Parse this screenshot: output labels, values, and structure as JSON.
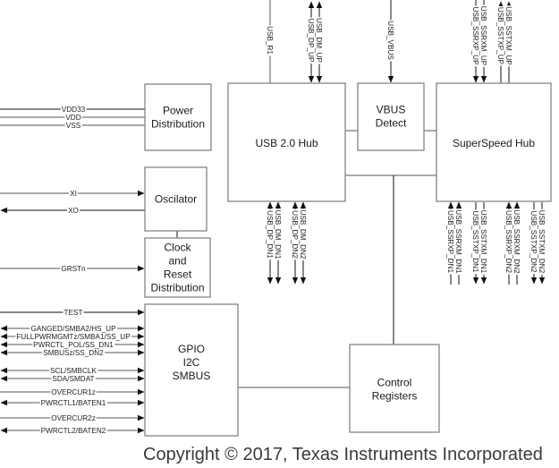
{
  "blocks": {
    "power": [
      "Power",
      "Distribution"
    ],
    "usb2hub": [
      "USB 2.0 Hub"
    ],
    "vbus": [
      "VBUS",
      "Detect"
    ],
    "sshub": [
      "SuperSpeed Hub"
    ],
    "oscillator": [
      "Oscilator"
    ],
    "clockreset": [
      "Clock",
      "and",
      "Reset",
      "Distribution"
    ],
    "gpio": [
      "GPIO",
      "I2C",
      "SMBUS"
    ],
    "control": [
      "Control",
      "Registers"
    ]
  },
  "signals": {
    "power": [
      "VDD33",
      "VDD",
      "VSS"
    ],
    "osc_in": "XI",
    "osc_out": "XO",
    "reset": "GRSTn",
    "gpio": [
      {
        "label": "TEST",
        "dir": "in"
      },
      {
        "label": "GANGED/SMBA2/HS_UP",
        "dir": "bi"
      },
      {
        "label": "FULLPWRMGMTz/SMBA1/SS_UP",
        "dir": "bi"
      },
      {
        "label": "PWRCTL_POL/SS_DN1",
        "dir": "bi"
      },
      {
        "label": "SMBUSz/SS_DN2",
        "dir": "bi"
      },
      {
        "label": "SCL/SMBCLK",
        "dir": "bi"
      },
      {
        "label": "SDA/SMDAT",
        "dir": "bi"
      },
      {
        "label": "OVERCUR1z",
        "dir": "in"
      },
      {
        "label": "PWRCTL1/BATEN1",
        "dir": "bi"
      },
      {
        "label": "OVERCUR2z",
        "dir": "in"
      },
      {
        "label": "PWRCTL2/BATEN2",
        "dir": "bi"
      }
    ],
    "usb2_up": {
      "r1": "USB_R1",
      "dp": "USB_DP_UP",
      "dm": "USB_DM_UP"
    },
    "vbus": "USB_VBUS",
    "ss_up": {
      "rxp": "USB_SSRXP_UP",
      "rxm": "USB_SSRXM_UP",
      "txp": "USB_SSTXP_UP",
      "txm": "USB_SSTXM_UP"
    },
    "usb2_dn": [
      "USB_DP_DN1",
      "USB_DM_DN1",
      "USB_DP_DN2",
      "USB_DM_DN2"
    ],
    "ss_dn": [
      "USB_SSRXP_DN1",
      "USB_SSRXM_DN1",
      "USB_SSTXP_DN1",
      "USB_SSTXM_DN1",
      "USB_SSRXP_DN2",
      "USB_SSRXM_DN2",
      "USB_SSTXP_DN2",
      "USB_SSTXM_DN2"
    ]
  },
  "copyright": "Copyright © 2017, Texas Instruments Incorporated"
}
